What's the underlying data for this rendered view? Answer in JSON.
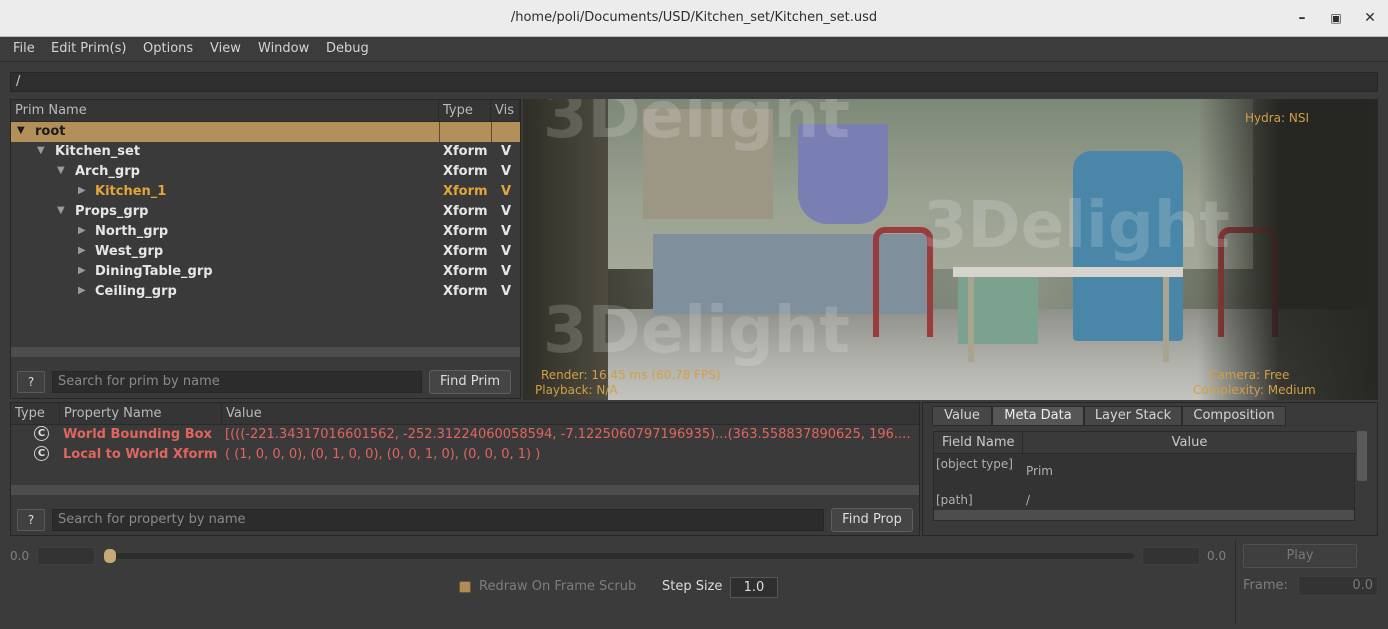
{
  "window": {
    "title": "/home/poli/Documents/USD/Kitchen_set/Kitchen_set.usd"
  },
  "menu": [
    "File",
    "Edit Prim(s)",
    "Options",
    "View",
    "Window",
    "Debug"
  ],
  "path": "/",
  "prim_tree": {
    "headers": {
      "name": "Prim Name",
      "type": "Type",
      "vis": "Vis"
    },
    "rows": [
      {
        "name": "root",
        "type": "",
        "vis": "",
        "selected": true
      },
      {
        "name": "Kitchen_set",
        "type": "Xform",
        "vis": "V"
      },
      {
        "name": "Arch_grp",
        "type": "Xform",
        "vis": "V"
      },
      {
        "name": "Kitchen_1",
        "type": "Xform",
        "vis": "V",
        "highlight": true
      },
      {
        "name": "Props_grp",
        "type": "Xform",
        "vis": "V"
      },
      {
        "name": "North_grp",
        "type": "Xform",
        "vis": "V"
      },
      {
        "name": "West_grp",
        "type": "Xform",
        "vis": "V"
      },
      {
        "name": "DiningTable_grp",
        "type": "Xform",
        "vis": "V"
      },
      {
        "name": "Ceiling_grp",
        "type": "Xform",
        "vis": "V"
      }
    ],
    "help_label": "?",
    "search_placeholder": "Search for prim by name",
    "find_label": "Find Prim"
  },
  "viewport": {
    "renderer": "Hydra: NSI",
    "render_stats": "Render: 16.45 ms (60.78 FPS)",
    "playback": "Playback: N/A",
    "camera": "Camera: Free",
    "complexity": "Complexity: Medium",
    "watermark": "3Delight"
  },
  "properties": {
    "headers": {
      "type": "Type",
      "name": "Property Name",
      "value": "Value"
    },
    "rows": [
      {
        "icon": "C",
        "name": "World Bounding Box",
        "value": "[(((-221.34317016601562, -252.31224060058594, -7.1225060797196935)...(363.558837890625, 196...."
      },
      {
        "icon": "C",
        "name": "Local to World Xform",
        "value": "( (1, 0, 0, 0), (0, 1, 0, 0), (0, 0, 1, 0), (0, 0, 0, 1) )"
      }
    ],
    "help_label": "?",
    "search_placeholder": "Search for property by name",
    "find_label": "Find Prop"
  },
  "tabs": {
    "items": [
      "Value",
      "Meta Data",
      "Layer Stack",
      "Composition"
    ],
    "active": "Meta Data",
    "metadata": {
      "headers": {
        "field": "Field Name",
        "value": "Value"
      },
      "rows": [
        {
          "field": "[object type]",
          "value": "Prim"
        },
        {
          "field": "[path]",
          "value": "/"
        }
      ]
    }
  },
  "timeline": {
    "start": "0.0",
    "end": "0.0",
    "play_label": "Play",
    "redraw_label": "Redraw On Frame Scrub",
    "step_label": "Step Size",
    "step_value": "1.0",
    "frame_label": "Frame:",
    "frame_value": "0.0"
  },
  "colors": {
    "accent": "#b3905a",
    "highlight_text": "#e3a53b",
    "property_text": "#e0655f"
  }
}
